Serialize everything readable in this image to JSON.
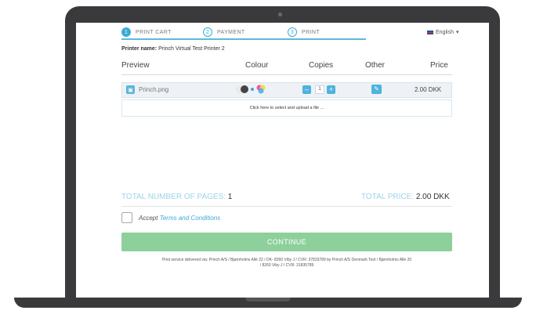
{
  "steps": [
    {
      "num": "1",
      "label": "PRINT CART"
    },
    {
      "num": "2",
      "label": "PAYMENT"
    },
    {
      "num": "3",
      "label": "PRINT"
    }
  ],
  "language": {
    "label": "English",
    "caret": "▾"
  },
  "printer": {
    "label": "Printer name:",
    "value": "Princh Virtual Test Printer 2"
  },
  "table": {
    "headers": {
      "preview": "Preview",
      "colour": "Colour",
      "copies": "Copies",
      "other": "Other",
      "price": "Price"
    },
    "row": {
      "filename": "Princh.png",
      "copies": "1",
      "price": "2.00 DKK",
      "minus": "–",
      "plus": "+"
    }
  },
  "upload": {
    "label": "Click here to select and upload a file ..."
  },
  "totals": {
    "pages_label": "TOTAL NUMBER OF PAGES:",
    "pages_value": "1",
    "price_label": "TOTAL PRICE:",
    "price_value": "2.00 DKK"
  },
  "terms": {
    "prefix": "Accept",
    "link": "Terms and Conditions"
  },
  "continue_label": "CONTINUE",
  "footer": {
    "line1": "Print service delivered via: Princh A/S  /  Bjørnholms Allé 22  / DK- 8260 Viby J  / CVR: 37833789 by Princh A/S Denmark Test  /  Bjørnholms Allé 20",
    "line2": "/ 8260 Viby J  /  CVR: 31835789"
  },
  "colors": {
    "accent": "#3aa9d6",
    "continue_bg": "#8dd09b",
    "frame": "#3a3a3c"
  }
}
